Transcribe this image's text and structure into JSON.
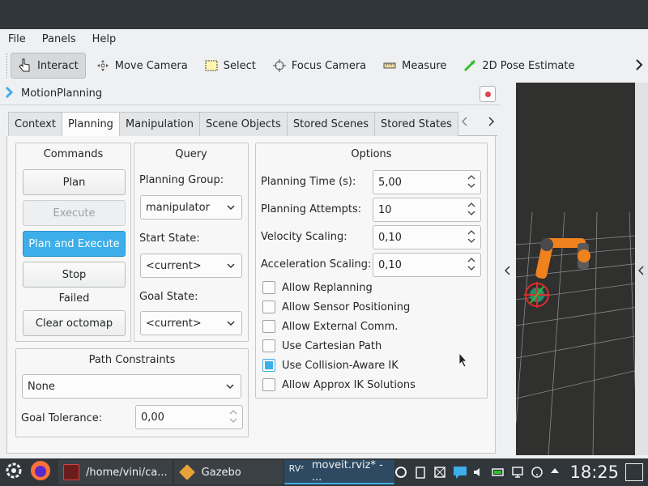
{
  "menubar": {
    "items": [
      "File",
      "Panels",
      "Help"
    ]
  },
  "toolbar": {
    "tools": [
      {
        "label": "Interact",
        "icon": "cursor-hand-icon",
        "active": true
      },
      {
        "label": "Move Camera",
        "icon": "move-camera-icon",
        "active": false
      },
      {
        "label": "Select",
        "icon": "select-rect-icon",
        "active": false
      },
      {
        "label": "Focus Camera",
        "icon": "focus-camera-icon",
        "active": false
      },
      {
        "label": "Measure",
        "icon": "measure-ruler-icon",
        "active": false
      },
      {
        "label": "2D Pose Estimate",
        "icon": "pose-arrow-icon",
        "active": false
      }
    ],
    "more_icon": "chevron-right-icon"
  },
  "panel": {
    "title": "MotionPlanning",
    "tabs": [
      "Context",
      "Planning",
      "Manipulation",
      "Scene Objects",
      "Stored Scenes",
      "Stored States"
    ],
    "active_tab": "Planning"
  },
  "commands": {
    "title": "Commands",
    "plan": "Plan",
    "execute": "Execute",
    "plan_execute": "Plan and Execute",
    "stop": "Stop",
    "status": "Failed",
    "clear_octomap": "Clear octomap"
  },
  "query": {
    "title": "Query",
    "group_label": "Planning Group:",
    "group_value": "manipulator",
    "start_label": "Start State:",
    "start_value": "<current>",
    "goal_label": "Goal State:",
    "goal_value": "<current>"
  },
  "options": {
    "title": "Options",
    "planning_time_label": "Planning Time (s):",
    "planning_time": "5,00",
    "attempts_label": "Planning Attempts:",
    "attempts": "10",
    "velocity_label": "Velocity Scaling:",
    "velocity": "0,10",
    "accel_label": "Acceleration Scaling:",
    "accel": "0,10",
    "checks": [
      {
        "label": "Allow Replanning",
        "checked": false
      },
      {
        "label": "Allow Sensor Positioning",
        "checked": false
      },
      {
        "label": "Allow External Comm.",
        "checked": false
      },
      {
        "label": "Use Cartesian Path",
        "checked": false
      },
      {
        "label": "Use Collision-Aware IK",
        "checked": true
      },
      {
        "label": "Allow Approx IK Solutions",
        "checked": false
      }
    ]
  },
  "constraints": {
    "title": "Path Constraints",
    "value": "None",
    "tolerance_label": "Goal Tolerance:",
    "tolerance": "0,00"
  },
  "taskbar": {
    "tasks": [
      {
        "label": "/home/vini/ca...",
        "icon": "terminal-icon",
        "active": false
      },
      {
        "label": "Gazebo",
        "icon": "gazebo-icon",
        "active": false
      },
      {
        "label": "moveit.rviz* - ...",
        "icon": "rviz-icon",
        "active": true
      }
    ],
    "clock": "18:25"
  },
  "colors": {
    "accent": "#3daee9",
    "titlebar": "#31363b",
    "viewport_bg": "#30302f",
    "robot_orange": "#f0821e"
  }
}
